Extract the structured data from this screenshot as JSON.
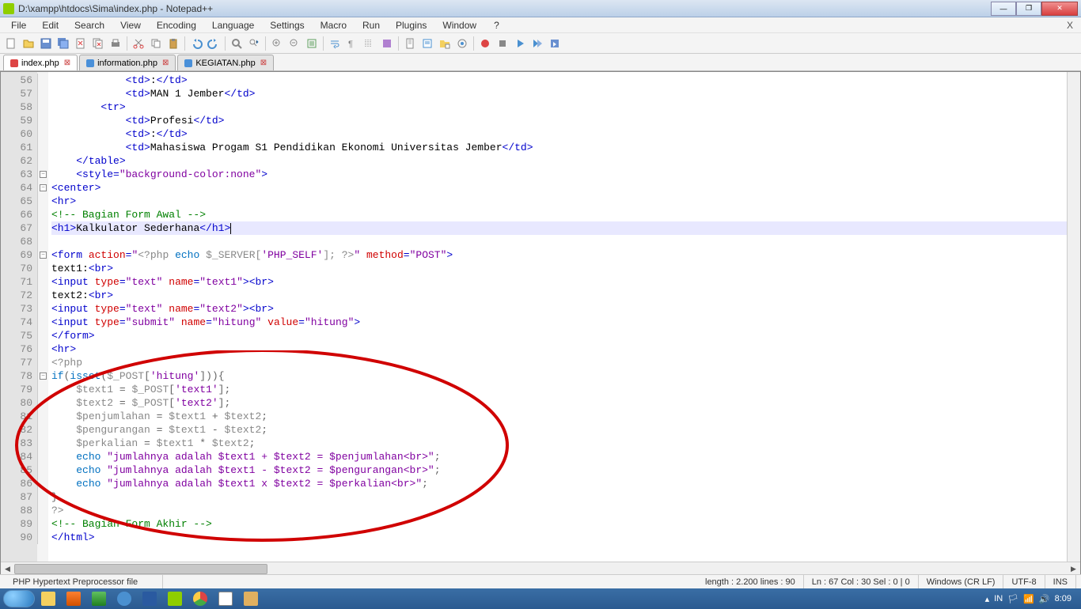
{
  "window": {
    "title": "D:\\xampp\\htdocs\\Sima\\index.php - Notepad++"
  },
  "menu": {
    "file": "File",
    "edit": "Edit",
    "search": "Search",
    "view": "View",
    "encoding": "Encoding",
    "language": "Language",
    "settings": "Settings",
    "macro": "Macro",
    "run": "Run",
    "plugins": "Plugins",
    "window": "Window",
    "help": "?",
    "close": "X"
  },
  "tabs": [
    {
      "label": "index.php",
      "active": true,
      "dirty": true
    },
    {
      "label": "information.php",
      "active": false,
      "dirty": false
    },
    {
      "label": "KEGIATAN.php",
      "active": false,
      "dirty": false
    }
  ],
  "lines": {
    "start": 56,
    "end": 90
  },
  "status": {
    "filetype": "PHP Hypertext Preprocessor file",
    "length": "length : 2.200    lines : 90",
    "pos": "Ln : 67    Col : 30    Sel : 0 | 0",
    "eol": "Windows (CR LF)",
    "enc": "UTF-8",
    "mode": "INS"
  },
  "tray": {
    "lang": "IN",
    "time": "8:09"
  }
}
